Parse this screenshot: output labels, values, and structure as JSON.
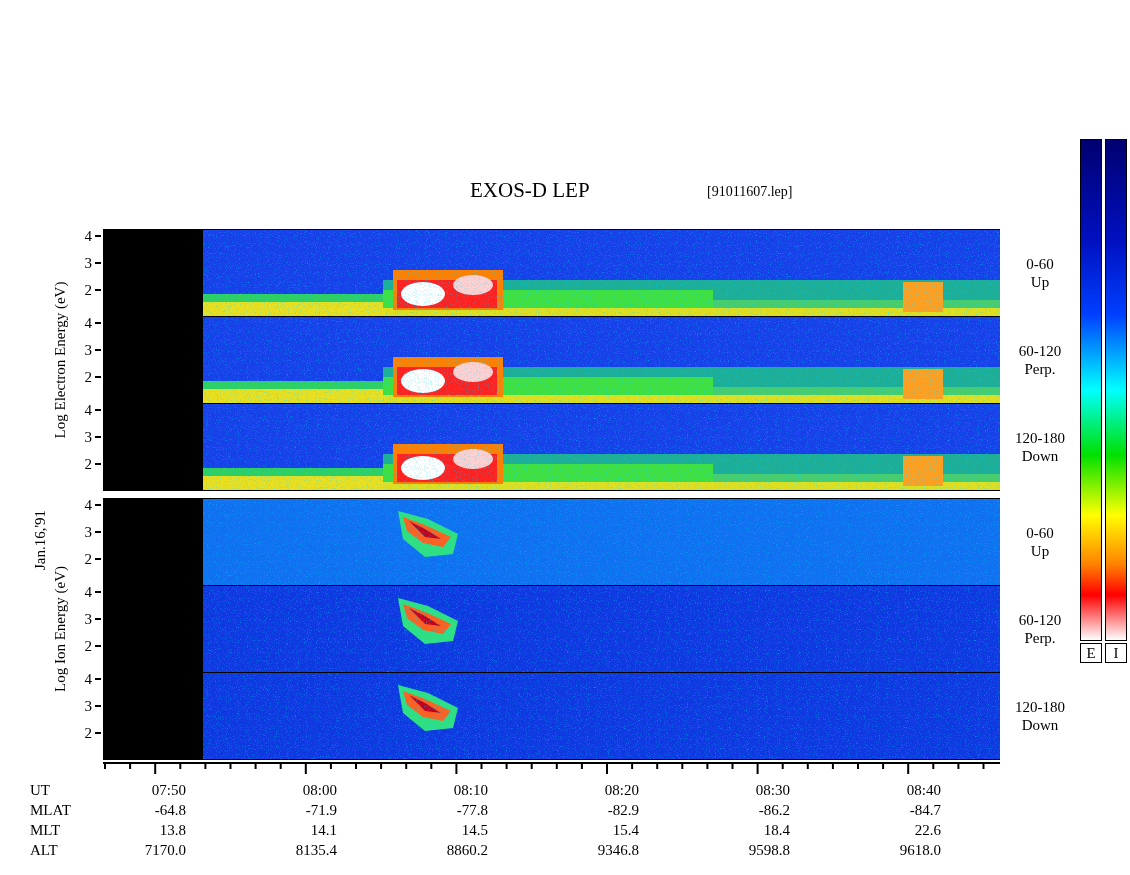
{
  "title": "EXOS-D LEP",
  "file_label": "[91011607.lep]",
  "date_label": "Jan.16,'91",
  "panels": [
    {
      "kind": "electron",
      "ylabel": "Log Electron Energy (eV)",
      "strips": [
        {
          "pitch": "0-60",
          "direction": "Up",
          "yticks": [
            "4",
            "3",
            "2"
          ]
        },
        {
          "pitch": "60-120",
          "direction": "Perp.",
          "yticks": [
            "4",
            "3",
            "2"
          ]
        },
        {
          "pitch": "120-180",
          "direction": "Down",
          "yticks": [
            "4",
            "3",
            "2"
          ]
        }
      ]
    },
    {
      "kind": "ion",
      "ylabel": "Log Ion Energy (eV)",
      "strips": [
        {
          "pitch": "0-60",
          "direction": "Up",
          "yticks": [
            "4",
            "3",
            "2"
          ]
        },
        {
          "pitch": "60-120",
          "direction": "Perp.",
          "yticks": [
            "4",
            "3",
            "2"
          ]
        },
        {
          "pitch": "120-180",
          "direction": "Down",
          "yticks": [
            "4",
            "3",
            "2"
          ]
        }
      ]
    }
  ],
  "colorbars": [
    {
      "label": "E"
    },
    {
      "label": "I"
    }
  ],
  "time_axis": [
    {
      "name": "UT",
      "values": [
        "07:50",
        "08:00",
        "08:10",
        "08:20",
        "08:30",
        "08:40"
      ]
    },
    {
      "name": "MLAT",
      "values": [
        "-64.8",
        "-71.9",
        "-77.8",
        "-82.9",
        "-86.2",
        "-84.7"
      ]
    },
    {
      "name": "MLT",
      "values": [
        "13.8",
        "14.1",
        "14.5",
        "15.4",
        "18.4",
        "22.6"
      ]
    },
    {
      "name": "ALT",
      "values": [
        "7170.0",
        "8135.4",
        "8860.2",
        "9346.8",
        "9598.8",
        "9618.0"
      ]
    }
  ]
}
